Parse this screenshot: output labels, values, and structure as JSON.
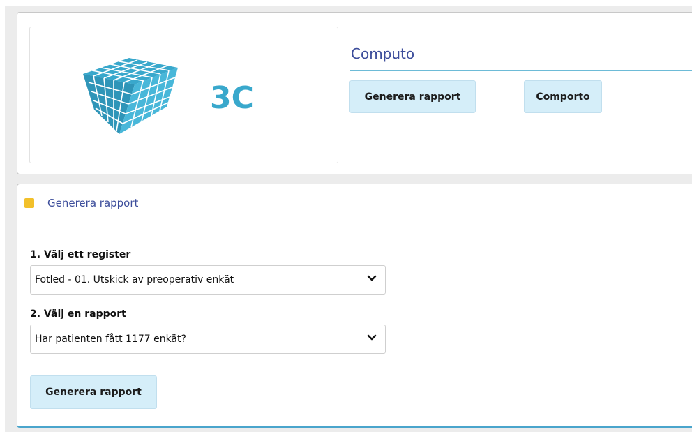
{
  "header": {
    "logo_text": "3C",
    "app_title": "Computo",
    "buttons": {
      "generate_report": "Generera rapport",
      "comporto": "Comporto"
    }
  },
  "report_panel": {
    "title": "Generera rapport",
    "step1_label": "1. Välj ett register",
    "step1_value": "Fotled - 01. Utskick av preoperativ enkät",
    "step2_label": "2. Välj en rapport",
    "step2_value": "Har patienten fått 1177 enkät?",
    "generate_button": "Generera rapport"
  },
  "icons": {
    "logo": "cube-logo-icon",
    "section": "square-icon",
    "dropdown": "chevron-down-icon"
  },
  "colors": {
    "accent": "#3c4d9b",
    "logo_blue": "#39a8cc",
    "button_bg": "#d5eef9",
    "section_icon": "#f2c02a",
    "rule": "#6dbbd7"
  }
}
